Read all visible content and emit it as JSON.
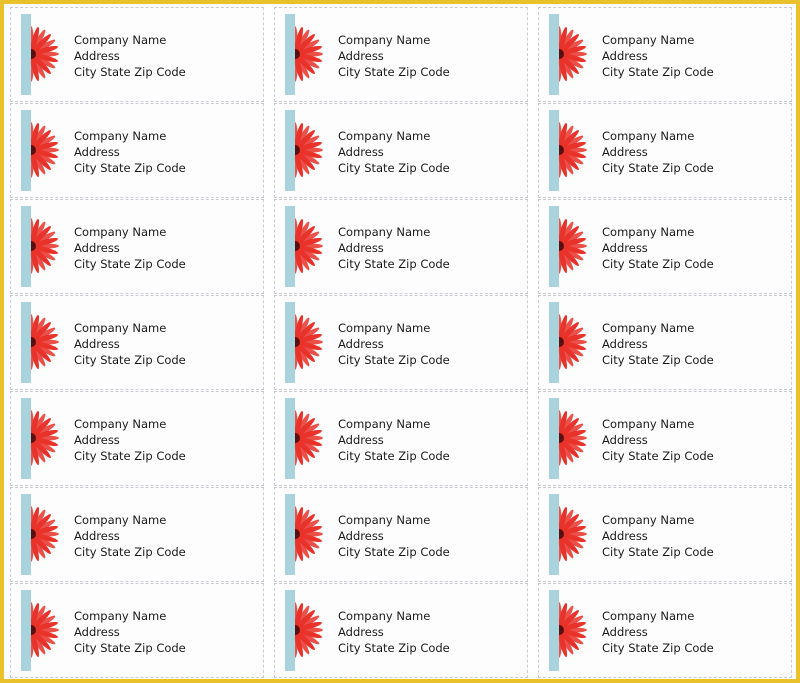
{
  "sheet": {
    "columns": 3,
    "rows": 7,
    "border_color": "#e9c22b",
    "accent_bar_color": "#a9d3dc",
    "flower_color": "#e8322a",
    "icon": "red-gerbera-flower",
    "labels": [
      {
        "company": "Company Name",
        "address": "Address",
        "city": "City State Zip Code"
      },
      {
        "company": "Company Name",
        "address": "Address",
        "city": "City State Zip Code"
      },
      {
        "company": "Company Name",
        "address": "Address",
        "city": "City State Zip Code"
      },
      {
        "company": "Company Name",
        "address": "Address",
        "city": "City State Zip Code"
      },
      {
        "company": "Company Name",
        "address": "Address",
        "city": "City State Zip Code"
      },
      {
        "company": "Company Name",
        "address": "Address",
        "city": "City State Zip Code"
      },
      {
        "company": "Company Name",
        "address": "Address",
        "city": "City State Zip Code"
      },
      {
        "company": "Company Name",
        "address": "Address",
        "city": "City State Zip Code"
      },
      {
        "company": "Company Name",
        "address": "Address",
        "city": "City State Zip Code"
      },
      {
        "company": "Company Name",
        "address": "Address",
        "city": "City State Zip Code"
      },
      {
        "company": "Company Name",
        "address": "Address",
        "city": "City State Zip Code"
      },
      {
        "company": "Company Name",
        "address": "Address",
        "city": "City State Zip Code"
      },
      {
        "company": "Company Name",
        "address": "Address",
        "city": "City State Zip Code"
      },
      {
        "company": "Company Name",
        "address": "Address",
        "city": "City State Zip Code"
      },
      {
        "company": "Company Name",
        "address": "Address",
        "city": "City State Zip Code"
      },
      {
        "company": "Company Name",
        "address": "Address",
        "city": "City State Zip Code"
      },
      {
        "company": "Company Name",
        "address": "Address",
        "city": "City State Zip Code"
      },
      {
        "company": "Company Name",
        "address": "Address",
        "city": "City State Zip Code"
      },
      {
        "company": "Company Name",
        "address": "Address",
        "city": "City State Zip Code"
      },
      {
        "company": "Company Name",
        "address": "Address",
        "city": "City State Zip Code"
      },
      {
        "company": "Company Name",
        "address": "Address",
        "city": "City State Zip Code"
      }
    ]
  }
}
